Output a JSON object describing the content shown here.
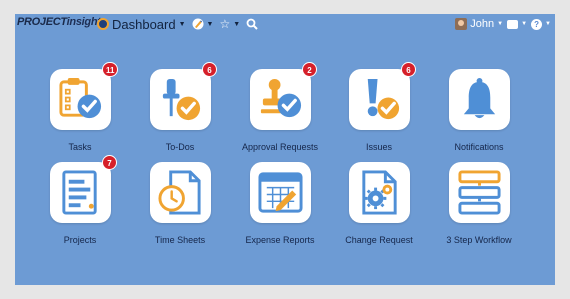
{
  "brand": {
    "part1": "PROJECT",
    "part2": "insight"
  },
  "nav": {
    "dashboard_label": "Dashboard",
    "user_name": "John"
  },
  "tiles": [
    {
      "label": "Tasks",
      "badge": "11"
    },
    {
      "label": "To-Dos",
      "badge": "6"
    },
    {
      "label": "Approval Requests",
      "badge": "2"
    },
    {
      "label": "Issues",
      "badge": "6"
    },
    {
      "label": "Notifications",
      "badge": ""
    },
    {
      "label": "Projects",
      "badge": "7"
    },
    {
      "label": "Time Sheets",
      "badge": ""
    },
    {
      "label": "Expense Reports",
      "badge": ""
    },
    {
      "label": "Change Request",
      "badge": ""
    },
    {
      "label": "3 Step Workflow",
      "badge": ""
    }
  ],
  "colors": {
    "background": "#6d9bd4",
    "accent": "#f0a431",
    "icon_blue": "#4f8fd6",
    "badge": "#d6202a"
  }
}
